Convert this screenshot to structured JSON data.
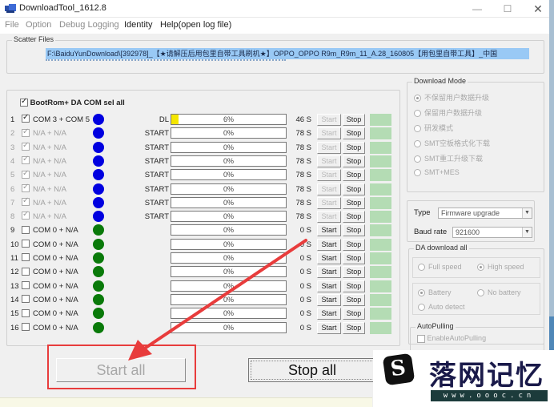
{
  "window": {
    "title": "DownloadTool_1612.8",
    "controls": {
      "minimize": "—",
      "maximize": "☐",
      "close": "✕"
    }
  },
  "menu": [
    {
      "label": "File",
      "enabled": false
    },
    {
      "label": "Option",
      "enabled": false
    },
    {
      "label": "Debug Logging",
      "enabled": false
    },
    {
      "label": "Identity",
      "enabled": true
    },
    {
      "label": "Help(open log file)",
      "enabled": true
    }
  ],
  "scatter": {
    "legend": "Scatter Files",
    "path": "F:\\BaiduYunDownload\\[392978]_【★请解压后用包里自带工具刷机★】OPPO_OPPO R9m_R9m_11_A.28_160805【用包里自带工具】_中国"
  },
  "ports": {
    "select_all_label": "BootRom+ DA COM sel all",
    "select_all_checked": true,
    "colors": {
      "blue_led": "#0000e0",
      "green_led": "#0a7a0a",
      "progress_fill": "#f4e600",
      "status_cell": "#b4dcb4"
    },
    "rows": [
      {
        "num": "1",
        "checked": true,
        "dim": false,
        "port": "COM 3 + COM 5",
        "led": "blue",
        "state": "DL",
        "progress": 6,
        "pct": "6%",
        "time": "46 S",
        "start": "Start",
        "start_enabled": false,
        "stop": "Stop"
      },
      {
        "num": "2",
        "checked": true,
        "dim": true,
        "port": "N/A + N/A",
        "led": "blue",
        "state": "START",
        "progress": 0,
        "pct": "0%",
        "time": "78 S",
        "start": "Start",
        "start_enabled": false,
        "stop": "Stop"
      },
      {
        "num": "3",
        "checked": true,
        "dim": true,
        "port": "N/A + N/A",
        "led": "blue",
        "state": "START",
        "progress": 0,
        "pct": "0%",
        "time": "78 S",
        "start": "Start",
        "start_enabled": false,
        "stop": "Stop"
      },
      {
        "num": "4",
        "checked": true,
        "dim": true,
        "port": "N/A + N/A",
        "led": "blue",
        "state": "START",
        "progress": 0,
        "pct": "0%",
        "time": "78 S",
        "start": "Start",
        "start_enabled": false,
        "stop": "Stop"
      },
      {
        "num": "5",
        "checked": true,
        "dim": true,
        "port": "N/A + N/A",
        "led": "blue",
        "state": "START",
        "progress": 0,
        "pct": "0%",
        "time": "78 S",
        "start": "Start",
        "start_enabled": false,
        "stop": "Stop"
      },
      {
        "num": "6",
        "checked": true,
        "dim": true,
        "port": "N/A + N/A",
        "led": "blue",
        "state": "START",
        "progress": 0,
        "pct": "0%",
        "time": "78 S",
        "start": "Start",
        "start_enabled": false,
        "stop": "Stop"
      },
      {
        "num": "7",
        "checked": true,
        "dim": true,
        "port": "N/A + N/A",
        "led": "blue",
        "state": "START",
        "progress": 0,
        "pct": "0%",
        "time": "78 S",
        "start": "Start",
        "start_enabled": false,
        "stop": "Stop"
      },
      {
        "num": "8",
        "checked": true,
        "dim": true,
        "port": "N/A + N/A",
        "led": "blue",
        "state": "START",
        "progress": 0,
        "pct": "0%",
        "time": "78 S",
        "start": "Start",
        "start_enabled": false,
        "stop": "Stop"
      },
      {
        "num": "9",
        "checked": false,
        "dim": false,
        "port": "COM 0 + N/A",
        "led": "green",
        "state": "",
        "progress": 0,
        "pct": "0%",
        "time": "0 S",
        "start": "Start",
        "start_enabled": true,
        "stop": "Stop"
      },
      {
        "num": "10",
        "checked": false,
        "dim": false,
        "port": "COM 0 + N/A",
        "led": "green",
        "state": "",
        "progress": 0,
        "pct": "0%",
        "time": "0 S",
        "start": "Start",
        "start_enabled": true,
        "stop": "Stop"
      },
      {
        "num": "11",
        "checked": false,
        "dim": false,
        "port": "COM 0 + N/A",
        "led": "green",
        "state": "",
        "progress": 0,
        "pct": "0%",
        "time": "0 S",
        "start": "Start",
        "start_enabled": true,
        "stop": "Stop"
      },
      {
        "num": "12",
        "checked": false,
        "dim": false,
        "port": "COM 0 + N/A",
        "led": "green",
        "state": "",
        "progress": 0,
        "pct": "0%",
        "time": "0 S",
        "start": "Start",
        "start_enabled": true,
        "stop": "Stop"
      },
      {
        "num": "13",
        "checked": false,
        "dim": false,
        "port": "COM 0 + N/A",
        "led": "green",
        "state": "",
        "progress": 0,
        "pct": "0%",
        "time": "0 S",
        "start": "Start",
        "start_enabled": true,
        "stop": "Stop"
      },
      {
        "num": "14",
        "checked": false,
        "dim": false,
        "port": "COM 0 + N/A",
        "led": "green",
        "state": "",
        "progress": 0,
        "pct": "0%",
        "time": "0 S",
        "start": "Start",
        "start_enabled": true,
        "stop": "Stop"
      },
      {
        "num": "15",
        "checked": false,
        "dim": false,
        "port": "COM 0 + N/A",
        "led": "green",
        "state": "",
        "progress": 0,
        "pct": "0%",
        "time": "0 S",
        "start": "Start",
        "start_enabled": true,
        "stop": "Stop"
      },
      {
        "num": "16",
        "checked": false,
        "dim": false,
        "port": "COM 0 + N/A",
        "led": "green",
        "state": "",
        "progress": 0,
        "pct": "0%",
        "time": "0 S",
        "start": "Start",
        "start_enabled": true,
        "stop": "Stop"
      }
    ]
  },
  "download_mode": {
    "legend": "Download Mode",
    "options": [
      {
        "label": "不保留用户数据升级",
        "selected": true
      },
      {
        "label": "保留用户数据升级",
        "selected": false
      },
      {
        "label": "研发模式",
        "selected": false
      },
      {
        "label": "SMT空板格式化下载",
        "selected": false
      },
      {
        "label": "SMT重工升级下载",
        "selected": false
      },
      {
        "label": "SMT+MES",
        "selected": false
      }
    ]
  },
  "settings": {
    "type_label": "Type",
    "type_value": "Firmware upgrade",
    "baud_label": "Baud rate",
    "baud_value": "921600",
    "dropdown_arrow": "▼"
  },
  "da_download": {
    "legend": "DA download all",
    "speed_options": [
      {
        "label": "Full speed",
        "selected": false
      },
      {
        "label": "High speed",
        "selected": true
      }
    ],
    "battery_options": [
      {
        "label": "Battery",
        "selected": true
      },
      {
        "label": "No battery",
        "selected": false
      },
      {
        "label": "Auto detect",
        "selected": false
      }
    ]
  },
  "autopulling": {
    "legend": "AutoPulling",
    "checkbox_label": "EnableAutoPulling",
    "checked": false
  },
  "actions": {
    "start_all": "Start all",
    "start_all_enabled": false,
    "stop_all": "Stop all"
  },
  "annotation": {
    "color": "#e83c3c"
  },
  "watermark": {
    "logo_glyph": "S",
    "text": "落网记忆",
    "url": "www.oooc.cn"
  }
}
